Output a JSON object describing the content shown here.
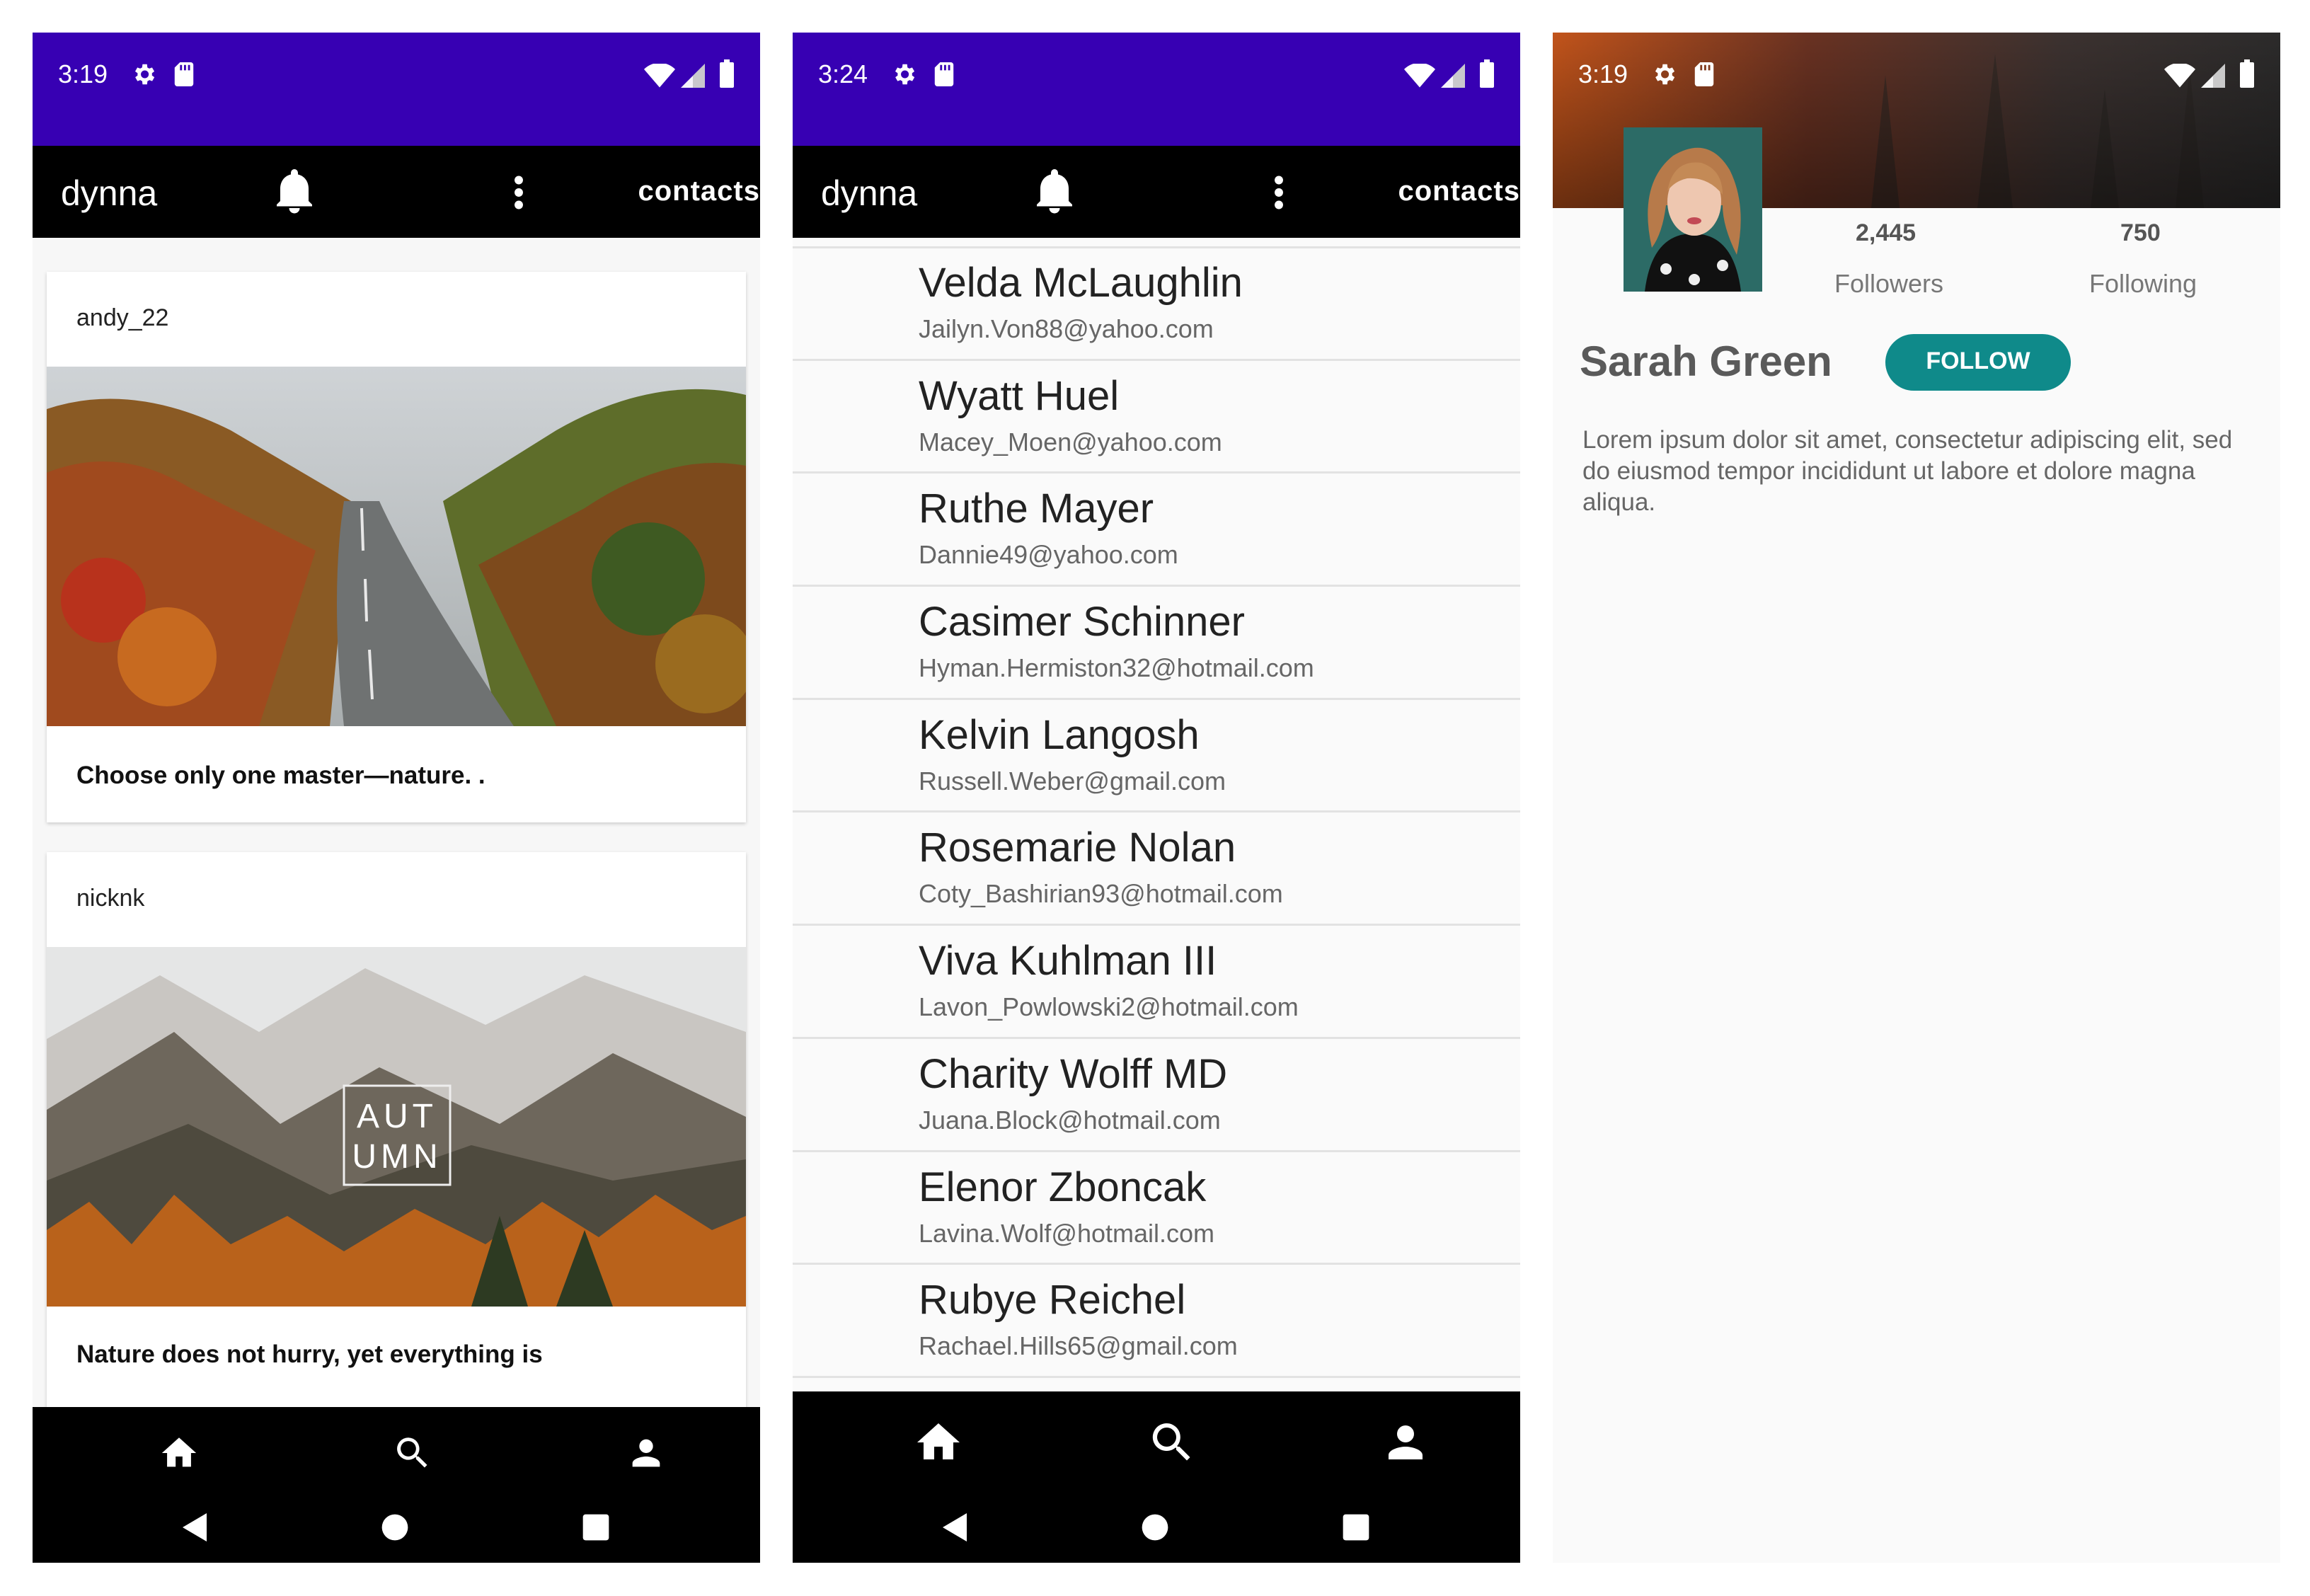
{
  "phones": [
    {
      "status": {
        "time": "3:19"
      },
      "appbar": {
        "title": "dynna",
        "action_label": "contacts"
      },
      "feed": [
        {
          "username": "andy_22",
          "caption": "Choose only one master—nature. ."
        },
        {
          "username": "nicknk",
          "caption": "Nature does not hurry, yet everything is",
          "image_text_line1": "AUT",
          "image_text_line2": "UMN"
        }
      ]
    },
    {
      "status": {
        "time": "3:24"
      },
      "appbar": {
        "title": "dynna",
        "action_label": "contacts"
      },
      "contacts": [
        {
          "name": "Velda McLaughlin",
          "email": "Jailyn.Von88@yahoo.com"
        },
        {
          "name": "Wyatt Huel",
          "email": "Macey_Moen@yahoo.com"
        },
        {
          "name": "Ruthe Mayer",
          "email": "Dannie49@yahoo.com"
        },
        {
          "name": "Casimer Schinner",
          "email": "Hyman.Hermiston32@hotmail.com"
        },
        {
          "name": "Kelvin Langosh",
          "email": "Russell.Weber@gmail.com"
        },
        {
          "name": "Rosemarie Nolan",
          "email": "Coty_Bashirian93@hotmail.com"
        },
        {
          "name": "Viva Kuhlman III",
          "email": "Lavon_Powlowski2@hotmail.com"
        },
        {
          "name": "Charity Wolff MD",
          "email": "Juana.Block@hotmail.com"
        },
        {
          "name": "Elenor Zboncak",
          "email": "Lavina.Wolf@hotmail.com"
        },
        {
          "name": "Rubye Reichel",
          "email": "Rachael.Hills65@gmail.com"
        }
      ]
    },
    {
      "status": {
        "time": "3:19"
      },
      "profile": {
        "name": "Sarah Green",
        "follow_label": "FOLLOW",
        "followers_count": "2,445",
        "followers_label": "Followers",
        "following_count": "750",
        "following_label": "Following",
        "bio": "Lorem ipsum dolor sit amet, consectetur adipiscing elit, sed do eiusmod tempor incididunt ut labore et dolore magna aliqua."
      }
    }
  ],
  "nav_icons": [
    "home-icon",
    "search-icon",
    "person-icon"
  ],
  "system_nav_icons": [
    "back-icon",
    "home-circle-icon",
    "recents-icon"
  ],
  "colors": {
    "status_bar": "#3700b3",
    "app_bar": "#000000",
    "follow_button": "#0f8a8a"
  }
}
